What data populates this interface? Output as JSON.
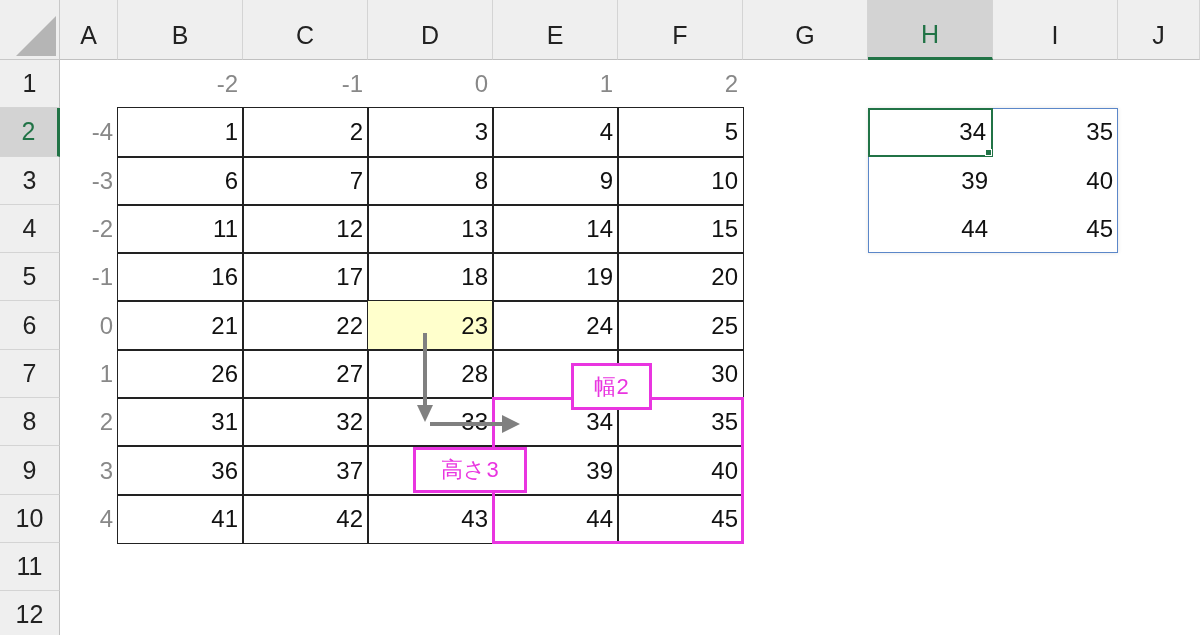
{
  "columns": [
    {
      "label": "A",
      "selected": false
    },
    {
      "label": "B",
      "selected": false
    },
    {
      "label": "C",
      "selected": false
    },
    {
      "label": "D",
      "selected": false
    },
    {
      "label": "E",
      "selected": false
    },
    {
      "label": "F",
      "selected": false
    },
    {
      "label": "G",
      "selected": false
    },
    {
      "label": "H",
      "selected": true
    },
    {
      "label": "I",
      "selected": false
    },
    {
      "label": "J",
      "selected": false
    }
  ],
  "rows": [
    {
      "label": "1",
      "selected": false,
      "cells": [
        {
          "kind": "empty"
        },
        {
          "kind": "label",
          "text": "-2",
          "selected": false,
          "highlighted": false
        },
        {
          "kind": "label",
          "text": "-1",
          "selected": false,
          "highlighted": false
        },
        {
          "kind": "label",
          "text": "0",
          "selected": false,
          "highlighted": false
        },
        {
          "kind": "label",
          "text": "1",
          "selected": false,
          "highlighted": false
        },
        {
          "kind": "label",
          "text": "2",
          "selected": false,
          "highlighted": false
        },
        {
          "kind": "empty"
        },
        {
          "kind": "empty"
        },
        {
          "kind": "empty"
        },
        {
          "kind": "empty"
        }
      ]
    },
    {
      "label": "2",
      "selected": true,
      "cells": [
        {
          "kind": "label",
          "text": "-4",
          "selected": false,
          "highlighted": false
        },
        {
          "kind": "table",
          "text": "1",
          "selected": false,
          "highlighted": false
        },
        {
          "kind": "table",
          "text": "2",
          "selected": false,
          "highlighted": false
        },
        {
          "kind": "table",
          "text": "3",
          "selected": false,
          "highlighted": false
        },
        {
          "kind": "table",
          "text": "4",
          "selected": false,
          "highlighted": false
        },
        {
          "kind": "table",
          "text": "5",
          "selected": false,
          "highlighted": false
        },
        {
          "kind": "empty"
        },
        {
          "kind": "result",
          "text": "34",
          "selected": true,
          "highlighted": false
        },
        {
          "kind": "result",
          "text": "35",
          "selected": false,
          "highlighted": false
        },
        {
          "kind": "empty"
        }
      ]
    },
    {
      "label": "3",
      "selected": false,
      "cells": [
        {
          "kind": "label",
          "text": "-3",
          "selected": false,
          "highlighted": false
        },
        {
          "kind": "table",
          "text": "6",
          "selected": false,
          "highlighted": false
        },
        {
          "kind": "table",
          "text": "7",
          "selected": false,
          "highlighted": false
        },
        {
          "kind": "table",
          "text": "8",
          "selected": false,
          "highlighted": false
        },
        {
          "kind": "table",
          "text": "9",
          "selected": false,
          "highlighted": false
        },
        {
          "kind": "table",
          "text": "10",
          "selected": false,
          "highlighted": false
        },
        {
          "kind": "empty"
        },
        {
          "kind": "result",
          "text": "39",
          "selected": false,
          "highlighted": false
        },
        {
          "kind": "result",
          "text": "40",
          "selected": false,
          "highlighted": false
        },
        {
          "kind": "empty"
        }
      ]
    },
    {
      "label": "4",
      "selected": false,
      "cells": [
        {
          "kind": "label",
          "text": "-2",
          "selected": false,
          "highlighted": false
        },
        {
          "kind": "table",
          "text": "11",
          "selected": false,
          "highlighted": false
        },
        {
          "kind": "table",
          "text": "12",
          "selected": false,
          "highlighted": false
        },
        {
          "kind": "table",
          "text": "13",
          "selected": false,
          "highlighted": false
        },
        {
          "kind": "table",
          "text": "14",
          "selected": false,
          "highlighted": false
        },
        {
          "kind": "table",
          "text": "15",
          "selected": false,
          "highlighted": false
        },
        {
          "kind": "empty"
        },
        {
          "kind": "result",
          "text": "44",
          "selected": false,
          "highlighted": false
        },
        {
          "kind": "result",
          "text": "45",
          "selected": false,
          "highlighted": false
        },
        {
          "kind": "empty"
        }
      ]
    },
    {
      "label": "5",
      "selected": false,
      "cells": [
        {
          "kind": "label",
          "text": "-1",
          "selected": false,
          "highlighted": false
        },
        {
          "kind": "table",
          "text": "16",
          "selected": false,
          "highlighted": false
        },
        {
          "kind": "table",
          "text": "17",
          "selected": false,
          "highlighted": false
        },
        {
          "kind": "table",
          "text": "18",
          "selected": false,
          "highlighted": false
        },
        {
          "kind": "table",
          "text": "19",
          "selected": false,
          "highlighted": false
        },
        {
          "kind": "table",
          "text": "20",
          "selected": false,
          "highlighted": false
        },
        {
          "kind": "empty"
        },
        {
          "kind": "empty"
        },
        {
          "kind": "empty"
        },
        {
          "kind": "empty"
        }
      ]
    },
    {
      "label": "6",
      "selected": false,
      "cells": [
        {
          "kind": "label",
          "text": "0",
          "selected": false,
          "highlighted": false
        },
        {
          "kind": "table",
          "text": "21",
          "selected": false,
          "highlighted": false
        },
        {
          "kind": "table",
          "text": "22",
          "selected": false,
          "highlighted": false
        },
        {
          "kind": "table",
          "text": "23",
          "selected": false,
          "highlighted": true
        },
        {
          "kind": "table",
          "text": "24",
          "selected": false,
          "highlighted": false
        },
        {
          "kind": "table",
          "text": "25",
          "selected": false,
          "highlighted": false
        },
        {
          "kind": "empty"
        },
        {
          "kind": "empty"
        },
        {
          "kind": "empty"
        },
        {
          "kind": "empty"
        }
      ]
    },
    {
      "label": "7",
      "selected": false,
      "cells": [
        {
          "kind": "label",
          "text": "1",
          "selected": false,
          "highlighted": false
        },
        {
          "kind": "table",
          "text": "26",
          "selected": false,
          "highlighted": false
        },
        {
          "kind": "table",
          "text": "27",
          "selected": false,
          "highlighted": false
        },
        {
          "kind": "table",
          "text": "28",
          "selected": false,
          "highlighted": false
        },
        {
          "kind": "table",
          "selected": false,
          "highlighted": false
        },
        {
          "kind": "table",
          "text": "30",
          "selected": false,
          "highlighted": false
        },
        {
          "kind": "empty"
        },
        {
          "kind": "empty"
        },
        {
          "kind": "empty"
        },
        {
          "kind": "empty"
        }
      ]
    },
    {
      "label": "8",
      "selected": false,
      "cells": [
        {
          "kind": "label",
          "text": "2",
          "selected": false,
          "highlighted": false
        },
        {
          "kind": "table",
          "text": "31",
          "selected": false,
          "highlighted": false
        },
        {
          "kind": "table",
          "text": "32",
          "selected": false,
          "highlighted": false
        },
        {
          "kind": "table",
          "text": "33",
          "selected": false,
          "highlighted": false
        },
        {
          "kind": "table",
          "text": "34",
          "selected": false,
          "highlighted": false
        },
        {
          "kind": "table",
          "text": "35",
          "selected": false,
          "highlighted": false
        },
        {
          "kind": "empty"
        },
        {
          "kind": "empty"
        },
        {
          "kind": "empty"
        },
        {
          "kind": "empty"
        }
      ]
    },
    {
      "label": "9",
      "selected": false,
      "cells": [
        {
          "kind": "label",
          "text": "3",
          "selected": false,
          "highlighted": false
        },
        {
          "kind": "table",
          "text": "36",
          "selected": false,
          "highlighted": false
        },
        {
          "kind": "table",
          "text": "37",
          "selected": false,
          "highlighted": false
        },
        {
          "kind": "table",
          "selected": false,
          "highlighted": false
        },
        {
          "kind": "table",
          "text": "39",
          "selected": false,
          "highlighted": false
        },
        {
          "kind": "table",
          "text": "40",
          "selected": false,
          "highlighted": false
        },
        {
          "kind": "empty"
        },
        {
          "kind": "empty"
        },
        {
          "kind": "empty"
        },
        {
          "kind": "empty"
        }
      ]
    },
    {
      "label": "10",
      "selected": false,
      "cells": [
        {
          "kind": "label",
          "text": "4",
          "selected": false,
          "highlighted": false
        },
        {
          "kind": "table",
          "text": "41",
          "selected": false,
          "highlighted": false
        },
        {
          "kind": "table",
          "text": "42",
          "selected": false,
          "highlighted": false
        },
        {
          "kind": "table",
          "text": "43",
          "selected": false,
          "highlighted": false
        },
        {
          "kind": "table",
          "text": "44",
          "selected": false,
          "highlighted": false
        },
        {
          "kind": "table",
          "text": "45",
          "selected": false,
          "highlighted": false
        },
        {
          "kind": "empty"
        },
        {
          "kind": "empty"
        },
        {
          "kind": "empty"
        },
        {
          "kind": "empty"
        }
      ]
    },
    {
      "label": "11",
      "selected": false,
      "cells": [
        {
          "kind": "empty"
        },
        {
          "kind": "empty"
        },
        {
          "kind": "empty"
        },
        {
          "kind": "empty"
        },
        {
          "kind": "empty"
        },
        {
          "kind": "empty"
        },
        {
          "kind": "empty"
        },
        {
          "kind": "empty"
        },
        {
          "kind": "empty"
        },
        {
          "kind": "empty"
        }
      ]
    },
    {
      "label": "12",
      "selected": false,
      "cells": [
        {
          "kind": "empty"
        },
        {
          "kind": "empty"
        },
        {
          "kind": "empty"
        },
        {
          "kind": "empty"
        },
        {
          "kind": "empty"
        },
        {
          "kind": "empty"
        },
        {
          "kind": "empty"
        },
        {
          "kind": "empty"
        },
        {
          "kind": "empty"
        },
        {
          "kind": "empty"
        }
      ]
    }
  ],
  "annotations": [
    {
      "kind": "callout",
      "text": "幅2"
    },
    {
      "kind": "callout",
      "text": "高さ3"
    }
  ]
}
